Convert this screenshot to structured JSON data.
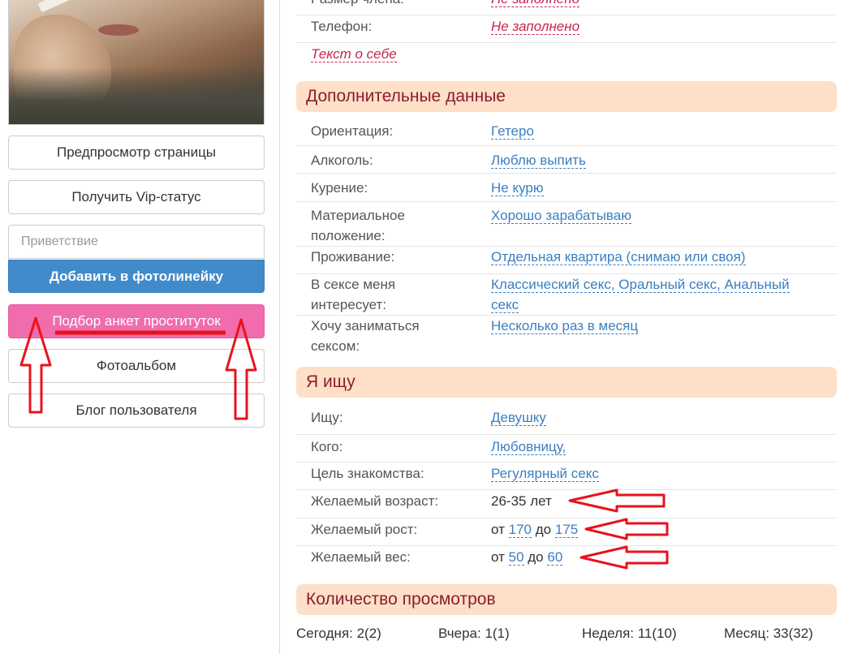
{
  "sidebar": {
    "preview_button": "Предпросмотр страницы",
    "vip_button": "Получить Vip-статус",
    "greeting_placeholder": "Приветствие",
    "add_photoline_button": "Добавить в фотолинейку",
    "escort_button": "Подбор анкет проституток",
    "photoalbum_button": "Фотоальбом",
    "blog_button": "Блог пользователя"
  },
  "profile": {
    "top_rows": [
      {
        "label": "Размер члена:",
        "value": "Не заполнено"
      },
      {
        "label": "Телефон:",
        "value": "Не заполнено"
      }
    ],
    "about_link": "Текст о себе"
  },
  "additional": {
    "title": "Дополнительные данные",
    "rows": [
      {
        "label": "Ориентация:",
        "value": "Гетеро"
      },
      {
        "label": "Алкоголь:",
        "value": "Люблю выпить"
      },
      {
        "label": "Курение:",
        "value": "Не курю"
      },
      {
        "label": "Материальное положение:",
        "value": "Хорошо зарабатываю"
      },
      {
        "label": "Проживание:",
        "value": "Отдельная квартира (снимаю или своя)"
      },
      {
        "label": "В сексе меня интересует:",
        "value": "Классический секс, Оральный секс, Анальный секс"
      },
      {
        "label": "Хочу заниматься сексом:",
        "value": "Несколько раз в месяц"
      }
    ]
  },
  "seeking": {
    "title": "Я ищу",
    "rows": [
      {
        "label": "Ищу:",
        "value": "Девушку"
      },
      {
        "label": "Кого:",
        "value": "Любовницу,"
      },
      {
        "label": "Цель знакомства:",
        "value": "Регулярный секс"
      }
    ],
    "age": {
      "label": "Желаемый возраст:",
      "value": "26-35 лет"
    },
    "height": {
      "label": "Желаемый рост:",
      "from_word": "от",
      "from": "170",
      "to_word": "до",
      "to": "175"
    },
    "weight": {
      "label": "Желаемый вес:",
      "from_word": "от",
      "from": "50",
      "to_word": "до",
      "to": "60"
    }
  },
  "views": {
    "title": "Количество просмотров",
    "today": "Сегодня: 2(2)",
    "yesterday": "Вчера: 1(1)",
    "week": "Неделя: 11(10)",
    "month": "Месяц: 33(32)"
  },
  "colors": {
    "section_bg": "#fde0c7",
    "section_title": "#8c1d2f",
    "link": "#3a7fc1",
    "empty_value": "#c7254e",
    "primary_button": "#428bca",
    "pink_button": "#f06cac",
    "annotation": "#e8121d"
  },
  "icons": {
    "annotation_arrows": "red-outline-arrow-icon"
  }
}
